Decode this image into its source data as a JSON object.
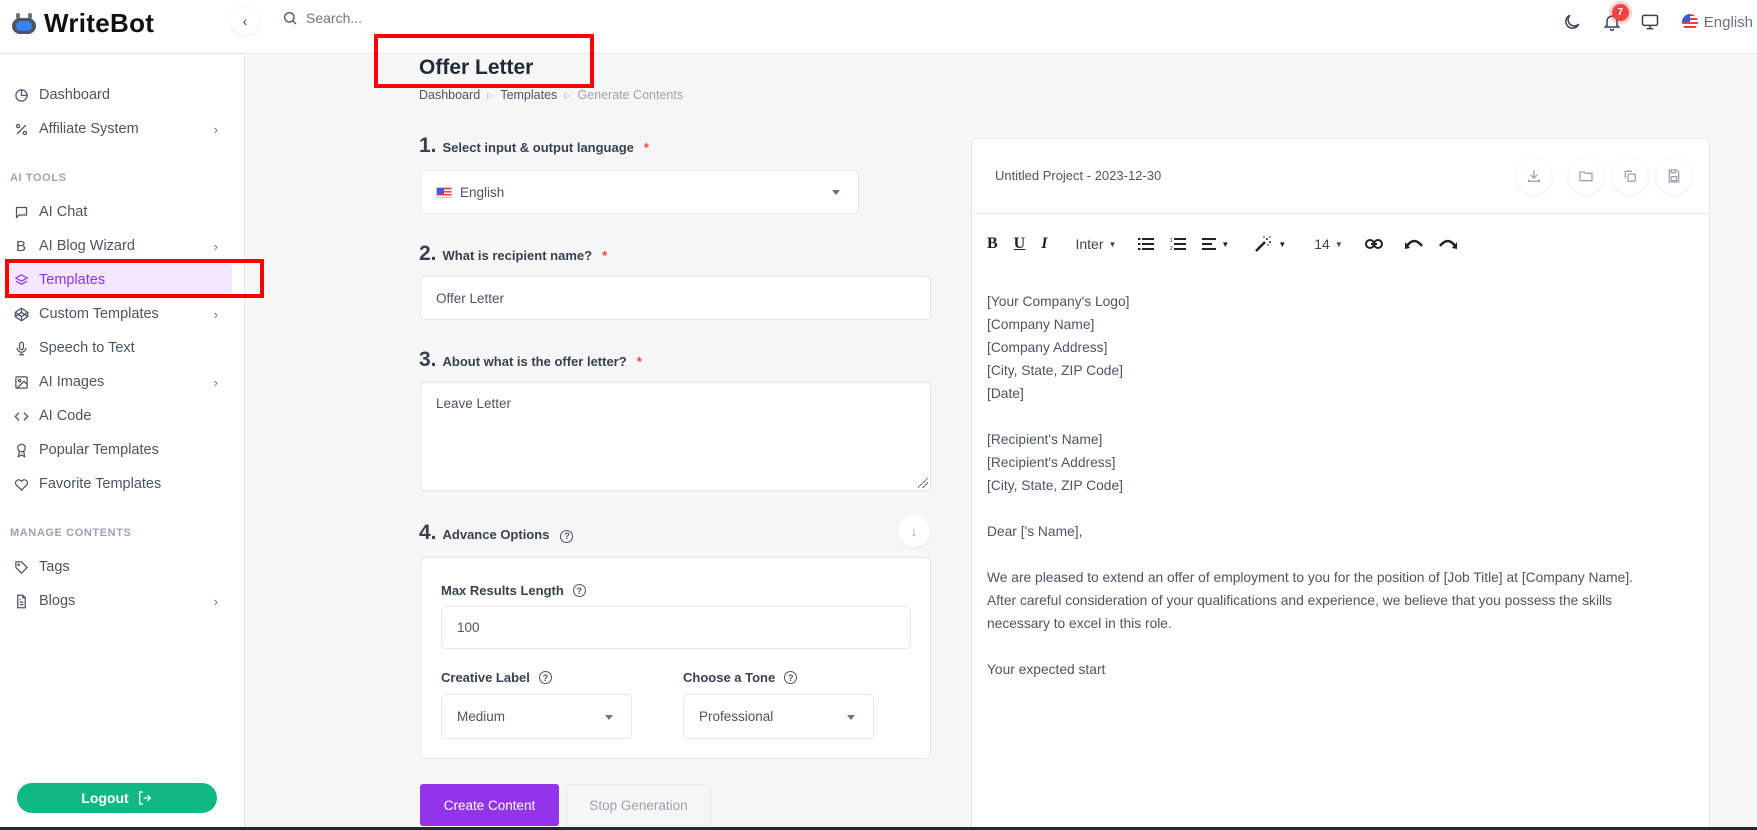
{
  "app": {
    "brand": "WriteBot",
    "search_placeholder": "Search...",
    "notification_count": "7",
    "language": "English"
  },
  "sidebar": {
    "items_top": [
      {
        "label": "Dashboard",
        "icon": "pie-chart-icon",
        "has_children": false
      },
      {
        "label": "Affiliate System",
        "icon": "percent-icon",
        "has_children": true
      }
    ],
    "section_ai_tools": "AI TOOLS",
    "items_ai": [
      {
        "label": "AI Chat",
        "icon": "chat-icon",
        "has_children": false
      },
      {
        "label": "AI Blog Wizard",
        "icon": "bold-b-icon",
        "has_children": true
      },
      {
        "label": "Templates",
        "icon": "layers-icon",
        "has_children": false,
        "active": true
      },
      {
        "label": "Custom Templates",
        "icon": "codepen-icon",
        "has_children": true
      },
      {
        "label": "Speech to Text",
        "icon": "microphone-icon",
        "has_children": false
      },
      {
        "label": "AI Images",
        "icon": "image-icon",
        "has_children": true
      },
      {
        "label": "AI Code",
        "icon": "code-icon",
        "has_children": false
      },
      {
        "label": "Popular Templates",
        "icon": "award-icon",
        "has_children": false
      },
      {
        "label": "Favorite Templates",
        "icon": "heart-icon",
        "has_children": false
      }
    ],
    "section_manage": "MANAGE CONTENTS",
    "items_manage": [
      {
        "label": "Tags",
        "icon": "tag-icon",
        "has_children": false
      },
      {
        "label": "Blogs",
        "icon": "file-text-icon",
        "has_children": true
      }
    ],
    "logout_label": "Logout"
  },
  "page": {
    "title": "Offer Letter",
    "breadcrumb": [
      "Dashboard",
      "Templates",
      "Generate Contents"
    ]
  },
  "form": {
    "q1": {
      "num": "1.",
      "label": "Select input & output language",
      "required": "*",
      "value": "English"
    },
    "q2": {
      "num": "2.",
      "label": "What is recipient name?",
      "required": "*",
      "value": "Offer Letter"
    },
    "q3": {
      "num": "3.",
      "label": "About what is the offer letter?",
      "required": "*",
      "value": "Leave Letter"
    },
    "q4": {
      "num": "4.",
      "label": "Advance Options"
    },
    "max_results": {
      "label": "Max Results Length",
      "value": "100"
    },
    "creative": {
      "label": "Creative Label",
      "value": "Medium"
    },
    "tone": {
      "label": "Choose a Tone",
      "value": "Professional"
    },
    "create_button": "Create Content",
    "stop_button": "Stop Generation"
  },
  "editor": {
    "project_title": "Untitled Project - 2023-12-30",
    "font_family": "Inter",
    "font_size": "14",
    "content_lines": [
      "[Your Company's Logo]",
      "[Company Name]",
      "[Company Address]",
      "[City, State, ZIP Code]",
      "[Date]",
      "",
      "[Recipient's Name]",
      "[Recipient's Address]",
      "[City, State, ZIP Code]",
      "",
      "Dear ['s Name],",
      "",
      "We are pleased to extend an offer of employment to you for the position of [Job Title] at [Company Name].",
      "After careful consideration of your qualifications and experience, we believe that you possess the skills",
      "necessary to excel in this role.",
      "",
      "Your expected start"
    ]
  },
  "colors": {
    "accent": "#9333ea",
    "active_bg": "#f3e8ff",
    "logout": "#10b981",
    "required": "#ef4444",
    "badge": "#ef4444",
    "annotation": "#ff0000"
  }
}
